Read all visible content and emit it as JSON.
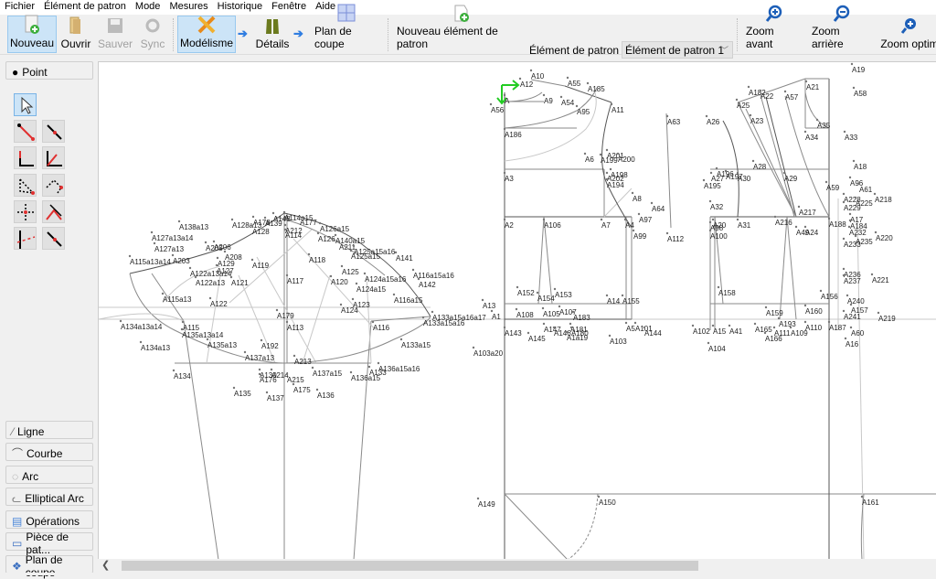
{
  "menu": [
    "Fichier",
    "Élément de patron",
    "Mode",
    "Mesures",
    "Historique",
    "Fenêtre",
    "Aide"
  ],
  "toolbar": {
    "nouveau": "Nouveau",
    "ouvrir": "Ouvrir",
    "sauver": "Sauver",
    "sync": "Sync",
    "modelisme": "Modélisme",
    "details": "Détails",
    "plan_de_coupe": "Plan de coupe",
    "nouvel_element": "Nouveau élément de patron",
    "element_label": "Élément de patron :",
    "element_value": "Élément de patron 1",
    "zoom_avant": "Zoom avant",
    "zoom_arriere": "Zoom arrière",
    "zoom_optimal": "Zoom optim"
  },
  "left_panel": {
    "point": "Point",
    "groups": [
      "Ligne",
      "Courbe",
      "Arc",
      "Elliptical Arc",
      "Opérations",
      "Pièce de pat...",
      "Plan de coupe"
    ]
  },
  "colors": {
    "accent": "#2f7de1",
    "selected": "#cce4f7",
    "tool_red": "#e03030",
    "axis_green": "#22cc22",
    "pattern_line": "#888888"
  },
  "points": [
    "A10",
    "A12",
    "A55",
    "A185",
    "A",
    "A9",
    "A54",
    "A56",
    "A95",
    "A11",
    "A186",
    "A63",
    "A6",
    "A199",
    "A201",
    "A200",
    "A198",
    "A202",
    "A194",
    "A3",
    "A8",
    "A64",
    "A97",
    "A2",
    "A106",
    "A7",
    "A4",
    "A99",
    "A112",
    "A152",
    "A154",
    "A153",
    "A14",
    "A155",
    "A13",
    "A1",
    "A108",
    "A105",
    "A107",
    "A183",
    "A143",
    "A145",
    "A147",
    "A146",
    "A181",
    "A180",
    "A1a19",
    "A5",
    "A101",
    "A103",
    "A144",
    "A103a20",
    "A102",
    "A15",
    "A41",
    "A104",
    "A19",
    "A21",
    "A182",
    "A22",
    "A57",
    "A58",
    "A25",
    "A23",
    "A26",
    "A35",
    "A34",
    "A33",
    "A28",
    "A18",
    "A196",
    "A27",
    "A197",
    "A30",
    "A29",
    "A195",
    "A96",
    "A61",
    "A59",
    "A218",
    "A228",
    "A229",
    "A225",
    "A32",
    "A217",
    "A216",
    "A31",
    "A188",
    "A17",
    "A184",
    "A20",
    "A98",
    "A100",
    "A49",
    "A24",
    "A232",
    "A220",
    "A233",
    "A235",
    "A221",
    "A236",
    "A237",
    "A158",
    "A156",
    "A240",
    "A159",
    "A160",
    "A157",
    "A241",
    "A219",
    "A165",
    "A193",
    "A111",
    "A109",
    "A110",
    "A187",
    "A60",
    "A166",
    "A16",
    "A149",
    "A150",
    "A161",
    "A138a13",
    "A128a13",
    "A178",
    "A139",
    "A148",
    "A114a15",
    "A177",
    "A126a15",
    "A127a13a14",
    "A128",
    "A212",
    "A114",
    "A127a13",
    "A206",
    "A205",
    "A126",
    "A140a15",
    "A211",
    "A125a15a16",
    "A115a13a14",
    "A203",
    "A208",
    "A118",
    "A129",
    "A119",
    "A125a15",
    "A141",
    "A122a13a14",
    "A127",
    "A125",
    "A116a15a16",
    "A122a13",
    "A121",
    "A117",
    "A120",
    "A124a15a16",
    "A142",
    "A115a13",
    "A124a15",
    "A116a15",
    "A122",
    "A123",
    "A124",
    "A179",
    "A133a15a16a17",
    "A133a15a16",
    "A134a13a14",
    "A115",
    "A113",
    "A116",
    "A135a13a14",
    "A134a13",
    "A135a13",
    "A192",
    "A133a15",
    "A137a13",
    "A213",
    "A136a15a16",
    "A134",
    "A130",
    "A176",
    "A214",
    "A215",
    "A137a15",
    "A133",
    "A136a15",
    "A175",
    "A135",
    "A137",
    "A136"
  ]
}
